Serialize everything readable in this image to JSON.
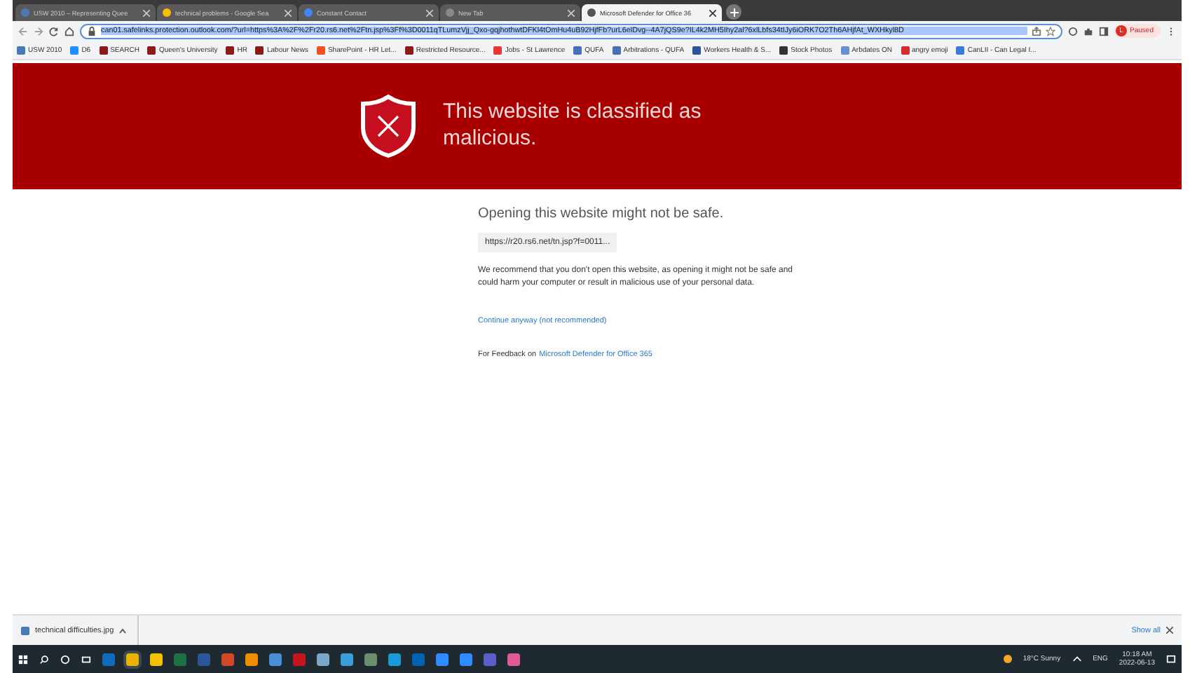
{
  "tabs": [
    {
      "title": "USW 2010 – Representing Quee",
      "selected": false
    },
    {
      "title": "technical problems - Google Sea",
      "selected": false
    },
    {
      "title": "Constant Contact",
      "selected": false
    },
    {
      "title": "New Tab",
      "selected": false
    },
    {
      "title": "Microsoft Defender for Office 36",
      "selected": true
    }
  ],
  "address_bar": {
    "url": "can01.safelinks.protection.outlook.com/?url=https%3A%2F%2Fr20.rs6.net%2Ftn.jsp%3Ff%3D0011qTLumzVjj_Qxo-gqjhothwtDFKl4tOmHu4uB92HjfFb?urL6elDvg--4A7jQS9e?IL4k2MH5Ihy2al?6xlLbfs34tIJy6iORK7O2Th6AHjfAt_WXHkyl8D"
  },
  "profile": {
    "initial": "L",
    "status": "Paused"
  },
  "bookmarks": [
    "USW 2010",
    "D6",
    "SEARCH",
    "Queen's University",
    "HR",
    "Labour News",
    "SharePoint - HR Let...",
    "Restricted Resource...",
    "Jobs - St Lawrence",
    "QUFA",
    "Arbitrations - QUFA",
    "Workers Health & S...",
    "Stock Photos",
    "Arbdates ON",
    "angry emoji",
    "CanLII - Can Legal I..."
  ],
  "banner": {
    "title": "This website is classified as malicious."
  },
  "warning": {
    "heading": "Opening this website might not be safe.",
    "blocked_url": "https://r20.rs6.net/tn.jsp?f=0011...",
    "message": "We recommend that you don't open this website, as opening it might not be safe and could harm your computer or result in malicious use of your personal data.",
    "continue_link": "Continue anyway (not recommended)",
    "feedback_label": "For Feedback on",
    "feedback_link": "Microsoft Defender for Office 365"
  },
  "download_bar": {
    "file": "technical difficulties.jpg",
    "show_all": "Show all"
  },
  "taskbar": {
    "apps": [
      {
        "color": "#0f6cbd",
        "selected": false
      },
      {
        "color": "#e8b400",
        "selected": true
      },
      {
        "color": "#f2c200",
        "selected": false
      },
      {
        "color": "#1e7145",
        "selected": false
      },
      {
        "color": "#2b579a",
        "selected": false
      },
      {
        "color": "#d24726",
        "selected": false
      },
      {
        "color": "#f08c00",
        "selected": false
      },
      {
        "color": "#4a8fd6",
        "selected": false
      },
      {
        "color": "#c4161c",
        "selected": false
      },
      {
        "color": "#7aa7c7",
        "selected": false
      },
      {
        "color": "#3a9fd8",
        "selected": false
      },
      {
        "color": "#6b8e6b",
        "selected": false
      },
      {
        "color": "#1a9ad6",
        "selected": false
      },
      {
        "color": "#0063b1",
        "selected": false
      },
      {
        "color": "#2d8cff",
        "selected": false
      },
      {
        "color": "#2d8cff",
        "selected": false
      },
      {
        "color": "#5b5fc7",
        "selected": false
      },
      {
        "color": "#e05a9a",
        "selected": false
      }
    ],
    "weather": "18°C  Sunny",
    "language": "ENG",
    "time": "10:18 AM",
    "date": "2022-06-13"
  }
}
